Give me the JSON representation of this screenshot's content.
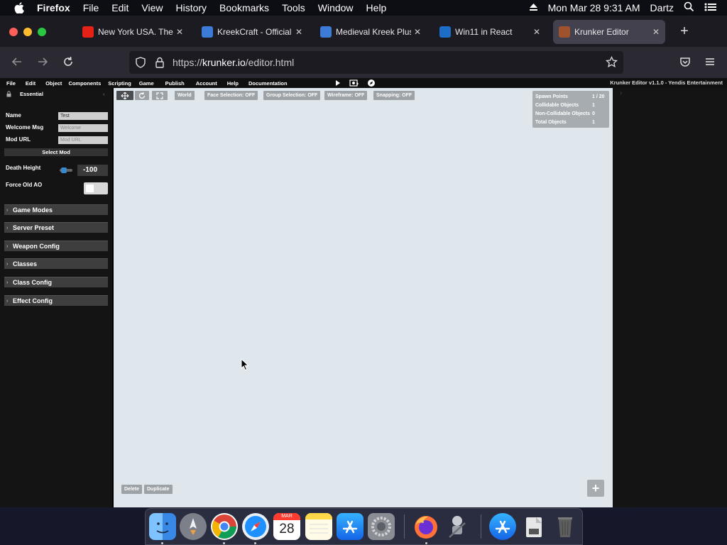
{
  "menubar": {
    "app_name": "Firefox",
    "items": [
      "File",
      "Edit",
      "View",
      "History",
      "Bookmarks",
      "Tools",
      "Window",
      "Help"
    ],
    "datetime": "Mon Mar 28  9:31 AM",
    "user": "Dartz"
  },
  "tabs": [
    {
      "title": "New York USA. The la",
      "favicon_color": "#e62117",
      "icon": "youtube-icon"
    },
    {
      "title": "KreekCraft - Official",
      "favicon_color": "#3d7bd8",
      "icon": "image-icon"
    },
    {
      "title": "Medieval Kreek Plush",
      "favicon_color": "#3d7bd8",
      "icon": "image-icon"
    },
    {
      "title": "Win11 in React",
      "favicon_color": "#1c6ec9",
      "icon": "react-icon"
    },
    {
      "title": "Krunker Editor",
      "favicon_color": "#a0522d",
      "icon": "krunker-icon"
    }
  ],
  "url": {
    "prefix": "https://",
    "domain": "krunker.io",
    "path": "/editor.html"
  },
  "editor": {
    "menu": [
      "File",
      "Edit",
      "Object",
      "Components",
      "Scripting",
      "Game",
      "Publish",
      "Account",
      "Help",
      "Documentation"
    ],
    "version": "Krunker Editor v1.1.0 - Yendis Entertainment",
    "section": "Essential",
    "fields": {
      "name_label": "Name",
      "name_value": "Test",
      "welcome_label": "Welcome Msg",
      "welcome_placeholder": "Welcome",
      "mod_url_label": "Mod URL",
      "mod_url_placeholder": "Mod URL",
      "select_mod": "Select Mod",
      "death_height_label": "Death Height",
      "death_height_value": "-100",
      "force_old_ao_label": "Force Old AO"
    },
    "accordions": [
      "Game Modes",
      "Server Preset",
      "Weapon Config",
      "Classes",
      "Class Config",
      "Effect Config"
    ],
    "toolbar": [
      "World",
      "Face Selection: OFF",
      "Group Selection: OFF",
      "Wireframe: OFF",
      "Snapping: OFF"
    ],
    "stats": [
      {
        "label": "Spawn Points",
        "value": "1 / 20"
      },
      {
        "label": "Collidable Objects",
        "value": "1"
      },
      {
        "label": "Non-Collidable Objects",
        "value": "0"
      },
      {
        "label": "Total Objects",
        "value": "1"
      }
    ],
    "bottom": {
      "delete": "Delete",
      "duplicate": "Duplicate"
    },
    "plus": "+"
  },
  "dock": [
    {
      "name": "finder-icon",
      "color": "#3aa0ff"
    },
    {
      "name": "launchpad-icon",
      "color": "#8b8f99"
    },
    {
      "name": "chrome-icon",
      "color": "#e8e8e8"
    },
    {
      "name": "safari-icon",
      "color": "#1e90ff"
    },
    {
      "name": "calendar-icon",
      "color": "#ffffff"
    },
    {
      "name": "notes-icon",
      "color": "#ffd84a"
    },
    {
      "name": "app-store-icon",
      "color": "#1e8bff"
    },
    {
      "name": "system-preferences-icon",
      "color": "#8a8d93"
    },
    {
      "name": "firefox-icon",
      "color": "#ff7139"
    },
    {
      "name": "automator-icon",
      "color": "#9aa0a8"
    },
    {
      "name": "app-store-download-icon",
      "color": "#1e8bff"
    },
    {
      "name": "disk-image-icon",
      "color": "#d8d8d8"
    },
    {
      "name": "trash-icon",
      "color": "#6b6b6b"
    }
  ],
  "calendar": {
    "month": "MAR",
    "day": "28"
  }
}
